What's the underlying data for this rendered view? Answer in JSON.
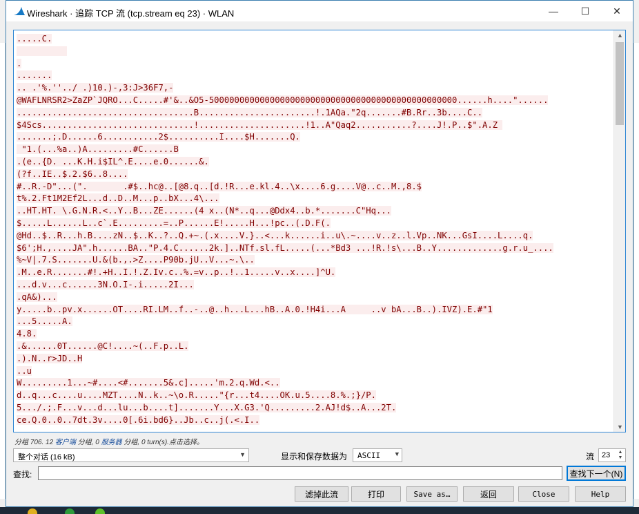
{
  "window": {
    "title": "Wireshark · 追踪 TCP 流 (tcp.stream eq 23) · WLAN",
    "min_glyph": "—",
    "max_glyph": "☐",
    "close_glyph": "✕",
    "accent": "#3c7fb1"
  },
  "stream": {
    "lines": [
      ".....C.",
      "          ",
      ".",
      ".......",
      ".. .'%.''../ .)10.)-,3:J>36F7,-",
      "@WAFLNRSR2>ZaZP`JQRO...C.....#'&..&O5-5000000000000000000000000000000000000000000000000......h....\"......",
      "...................................B.......................!.1AQa.\"2q.......#B.Rr..3b....C..",
      "$4Scs..............................!.....................!1..A\"Qaq2...........?....J!.P..$\".A.Z ",
      ".......;.D......6...........2$..........I....$H.......Q.",
      " \"1.(...%a..)A.........#C......B",
      ".(e..{D. ...K.H.i$IL^.E....e.0......&.",
      "(?f..IE..$.2.$6..8....",
      "#..R.-D\"...(\".       .#$..hc@..[@8.q..[d.!R...e.kl.4..\\x....6.g....V@..c..M.,8.$",
      "t%.2.Ft1M2Ef2L...d..D..M...p..bX...4\\...",
      "..HT.HT. \\.G.N.R.<..Y..B...ZE......(4 x..(N*..q...@Ddx4..b.*.......C\"Hq...",
      "$.....L......L..c`.E.........=..P......E!.....H...!pc..(.D.F(.",
      "@Hd..$..R...h.B....zN..$..K..?..Q.+~.(.x....V.}..<...k......i..u\\.~....v..z..l.Vp..NK...GsI....L....q.",
      "$6';H.,....JA\".h......BA..\"P.4.C......2k.]..NTf.sl.fL.....(...*Bd3 ...!R.!s\\...B..Y.............g.r.u_....",
      "%~V|.7.S.......U.&(b.,.>Z....P90b.jU..V...~.\\..",
      ".M..e.R.......#!.+H..I.!.Z.Iv.c..%.=v..p..!..1.....v..x....]^U.",
      "...d.v...c......3N.O.I-.i.....2I...",
      ".qA&)...",
      "y.....b..pv.x......OT....RI.LM..f..-..@..h...L...hB..A.0.!H4i...A     ..v bA...B..).IVZ).E.#\"1",
      "...5.....A.",
      "4.8.",
      ".&......0T......@C!....~(..F.p..L.",
      ".).N..r>JD..H",
      "..u",
      "W.........1...~#....<#.......5&.c].....'m.2.q.Wd.<..",
      "d..q...c....u....MZT....N..k..~\\o.R.....\"{r...t4....OK.u.5....8.%.;}/P.",
      "5.../.;.F...v...d...lu...b....t].......Y...X.G3.'Q.........2.AJ!d$..A...2T.",
      "ce.Q.0..0..7dt.3v....0[.6i.bd6}..Jb..c..j(.<.I.."
    ],
    "text_color": "#7f0000",
    "highlight_color": "#fbeded"
  },
  "status": {
    "text1": "分组 706. 12 ",
    "client_link": "客户端",
    "text2": " 分组, 0 ",
    "server_link": "服务器",
    "text3": " 分组, 0 turn(s).点击选择。"
  },
  "controls": {
    "conversation_select": "整个对话 (16 kB)",
    "save_as_label": "显示和保存数据为",
    "format_select": "ASCII",
    "stream_label": "流",
    "stream_value": "23",
    "find_label": "查找:",
    "find_value": "",
    "find_next_button": "查找下一个(N)",
    "filter_out_button": "滤掉此流",
    "print_button": "打印",
    "save_as_button": "Save as…",
    "back_button": "返回",
    "close_button": "Close",
    "help_button": "Help"
  }
}
